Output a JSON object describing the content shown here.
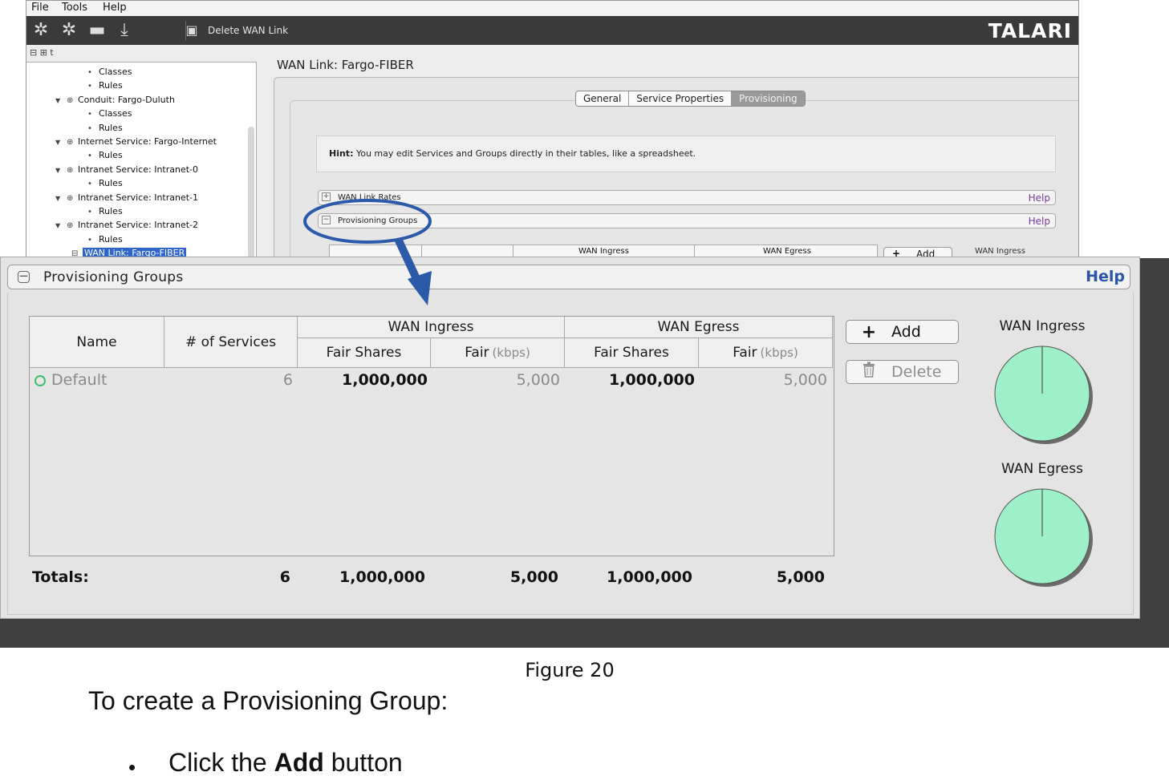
{
  "menubar": {
    "items": [
      "File",
      "Tools",
      "Help"
    ]
  },
  "toolbar": {
    "icons": [
      "gear-add-icon",
      "gear-icon",
      "folder-icon",
      "download-icon"
    ],
    "delete_label": "Delete WAN Link",
    "brand": "TALARI"
  },
  "tree": {
    "tool_glyphs": "⊟ ⊞ t",
    "nodes": [
      {
        "label": "Classes",
        "kind": "bullet"
      },
      {
        "label": "Rules",
        "kind": "bullet"
      },
      {
        "label": "Conduit: Fargo-Duluth",
        "kind": "parent"
      },
      {
        "label": "Classes",
        "kind": "bullet"
      },
      {
        "label": "Rules",
        "kind": "bullet"
      },
      {
        "label": "Internet Service: Fargo-Internet",
        "kind": "parent"
      },
      {
        "label": "Rules",
        "kind": "bullet"
      },
      {
        "label": "Intranet Service: Intranet-0",
        "kind": "parent"
      },
      {
        "label": "Rules",
        "kind": "bullet"
      },
      {
        "label": "Intranet Service: Intranet-1",
        "kind": "parent"
      },
      {
        "label": "Rules",
        "kind": "bullet"
      },
      {
        "label": "Intranet Service: Intranet-2",
        "kind": "parent"
      },
      {
        "label": "Rules",
        "kind": "bullet"
      },
      {
        "label": "WAN Link: Fargo-FIBER",
        "kind": "selected"
      }
    ]
  },
  "main": {
    "title": "WAN Link: Fargo-FIBER",
    "tabs": [
      {
        "label": "General",
        "active": false
      },
      {
        "label": "Service Properties",
        "active": false
      },
      {
        "label": "Provisioning",
        "active": true
      }
    ],
    "hint_bold": "Hint:",
    "hint_text": " You may edit Services and Groups directly in their tables, like a spreadsheet.",
    "sections": [
      {
        "label": "WAN Link Rates",
        "help": "Help",
        "expanded": false
      },
      {
        "label": "Provisioning Groups",
        "help": "Help",
        "expanded": true
      }
    ],
    "mini_ingress_header": "WAN Ingress",
    "mini_egress_header": "WAN Egress",
    "mini_add_label": "Add",
    "mini_ingress_label": "WAN Ingress"
  },
  "panel": {
    "title": "Provisioning Groups",
    "help": "Help",
    "headers": {
      "name": "Name",
      "services": "# of Services",
      "wan_ingress": "WAN Ingress",
      "wan_egress": "WAN Egress",
      "fair_shares": "Fair Shares",
      "fair": "Fair",
      "kbps": "(kbps)"
    },
    "rows": [
      {
        "name": "Default",
        "services": "6",
        "ingress_fair_shares": "1,000,000",
        "ingress_fair_kbps": "5,000",
        "egress_fair_shares": "1,000,000",
        "egress_fair_kbps": "5,000"
      }
    ],
    "totals": {
      "label": "Totals:",
      "services": "6",
      "ingress_fair_shares": "1,000,000",
      "ingress_fair_kbps": "5,000",
      "egress_fair_shares": "1,000,000",
      "egress_fair_kbps": "5,000"
    },
    "buttons": {
      "add": "Add",
      "delete": "Delete"
    },
    "charts": [
      {
        "label": "WAN Ingress",
        "share": 1.0,
        "color": "#9ef0c8"
      },
      {
        "label": "WAN Egress",
        "share": 1.0,
        "color": "#9ef0c8"
      }
    ],
    "status_color": "#3fbf6a"
  },
  "document": {
    "caption": "Figure 20",
    "paragraph": "To create a Provisioning Group:",
    "bullet": "•",
    "step_pre": "Click the ",
    "step_bold": "Add",
    "step_post": " button"
  }
}
